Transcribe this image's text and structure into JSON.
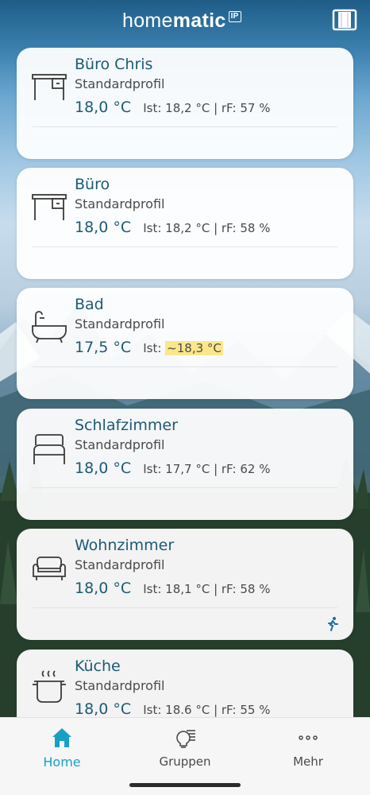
{
  "header": {
    "logo_light": "home",
    "logo_bold": "matic",
    "logo_badge": "IP",
    "menu_icon": "door-panel-icon"
  },
  "rooms": [
    {
      "name": "Büro Chris",
      "profile": "Standardprofil",
      "setpoint": "18,0 °C",
      "measured": "Ist: 18,2 °C  |  rF: 57 %",
      "icon": "desk-icon"
    },
    {
      "name": "Büro",
      "profile": "Standardprofil",
      "setpoint": "18,0 °C",
      "measured": "Ist: 18,2 °C  |  rF: 58 %",
      "icon": "desk-icon"
    },
    {
      "name": "Bad",
      "profile": "Standardprofil",
      "setpoint": "17,5 °C",
      "measured_prefix": "Ist: ",
      "measured_highlight": "~18,3 °C",
      "icon": "bathtub-icon"
    },
    {
      "name": "Schlafzimmer",
      "profile": "Standardprofil",
      "setpoint": "18,0 °C",
      "measured": "Ist: 17,7 °C  |  rF: 62 %",
      "icon": "bed-icon"
    },
    {
      "name": "Wohnzimmer",
      "profile": "Standardprofil",
      "setpoint": "18,0 °C",
      "measured": "Ist: 18,1 °C  |  rF: 58 %",
      "icon": "sofa-icon",
      "status_icon": "running-person-icon"
    },
    {
      "name": "Küche",
      "profile": "Standardprofil",
      "setpoint": "18,0 °C",
      "measured": "Ist: 18.6 °C  |  rF: 55 %",
      "icon": "cooking-pot-icon"
    }
  ],
  "tabs": [
    {
      "label": "Home",
      "icon": "home-icon",
      "active": true
    },
    {
      "label": "Gruppen",
      "icon": "lightbulb-list-icon",
      "active": false
    },
    {
      "label": "Mehr",
      "icon": "more-dots-icon",
      "active": false
    }
  ],
  "colors": {
    "accent": "#17a0c4",
    "setpoint_text": "#1d5a73",
    "highlight": "#fbe78a"
  }
}
